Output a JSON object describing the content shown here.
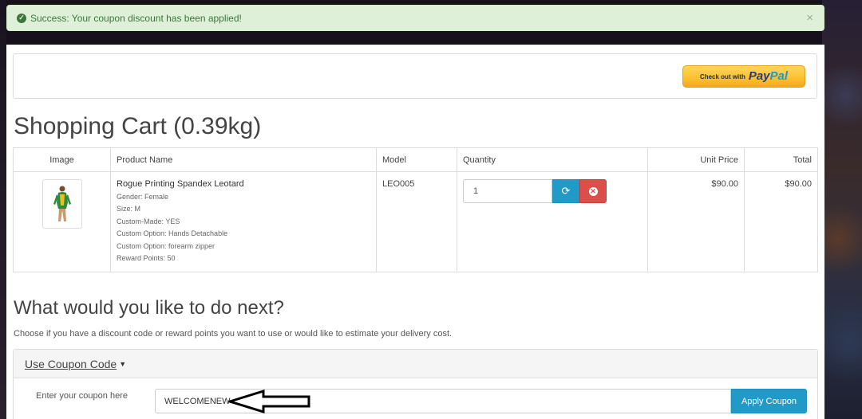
{
  "alert": {
    "message": "Success: Your coupon discount has been applied!",
    "close": "×"
  },
  "paypal": {
    "prefix": "Check out with",
    "brand_pay": "Pay",
    "brand_pal": "Pal"
  },
  "cart": {
    "title": "Shopping Cart  (0.39kg)",
    "columns": {
      "image": "Image",
      "product_name": "Product Name",
      "model": "Model",
      "quantity": "Quantity",
      "unit_price": "Unit Price",
      "total": "Total"
    },
    "items": [
      {
        "name": "Rogue Printing Spandex Leotard",
        "options": [
          "Gender: Female",
          "Size: M",
          "Custom-Made: YES",
          "Custom Option: Hands Detachable",
          "Custom Option: forearm zipper",
          "Reward Points: 50"
        ],
        "model": "LEO005",
        "quantity": "1",
        "unit_price": "$90.00",
        "total": "$90.00"
      }
    ]
  },
  "next": {
    "heading": "What would you like to do next?",
    "hint": "Choose if you have a discount code or reward points you want to use or would like to estimate your delivery cost."
  },
  "coupon": {
    "panel_title": "Use Coupon Code",
    "label": "Enter your coupon here",
    "value": "WELCOMENEW",
    "apply_label": "Apply Coupon"
  },
  "colors": {
    "success_bg": "#dff0d8",
    "success_text": "#3c763d",
    "primary_blue": "#229ac8",
    "danger_red": "#da4f49",
    "paypal_yellow": "#fbc02d"
  }
}
